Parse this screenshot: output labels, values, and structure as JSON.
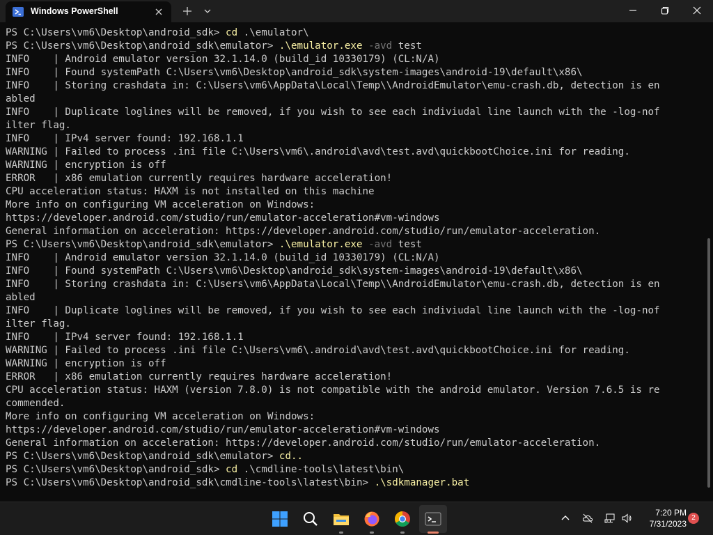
{
  "window": {
    "tab_title": "Windows PowerShell"
  },
  "terminal": {
    "lines": [
      [
        {
          "t": "PS C:\\Users\\vm6\\Desktop\\android_sdk> ",
          "c": ""
        },
        {
          "t": "cd",
          "c": "cmd"
        },
        {
          "t": " .\\emulator\\",
          "c": ""
        }
      ],
      [
        {
          "t": "PS C:\\Users\\vm6\\Desktop\\android_sdk\\emulator> ",
          "c": ""
        },
        {
          "t": ".\\emulator.exe",
          "c": "cmd"
        },
        {
          "t": " ",
          "c": ""
        },
        {
          "t": "-avd",
          "c": "param"
        },
        {
          "t": " test",
          "c": ""
        }
      ],
      [
        {
          "t": "INFO    | Android emulator version 32.1.14.0 (build_id 10330179) (CL:N/A)",
          "c": ""
        }
      ],
      [
        {
          "t": "INFO    | Found systemPath C:\\Users\\vm6\\Desktop\\android_sdk\\system-images\\android-19\\default\\x86\\",
          "c": ""
        }
      ],
      [
        {
          "t": "INFO    | Storing crashdata in: C:\\Users\\vm6\\AppData\\Local\\Temp\\\\AndroidEmulator\\emu-crash.db, detection is en",
          "c": ""
        }
      ],
      [
        {
          "t": "abled",
          "c": ""
        }
      ],
      [
        {
          "t": "INFO    | Duplicate loglines will be removed, if you wish to see each indiviudal line launch with the -log-nof",
          "c": ""
        }
      ],
      [
        {
          "t": "ilter flag.",
          "c": ""
        }
      ],
      [
        {
          "t": "INFO    | IPv4 server found: 192.168.1.1",
          "c": ""
        }
      ],
      [
        {
          "t": "WARNING | Failed to process .ini file C:\\Users\\vm6\\.android\\avd\\test.avd\\quickbootChoice.ini for reading.",
          "c": ""
        }
      ],
      [
        {
          "t": "WARNING | encryption is off",
          "c": ""
        }
      ],
      [
        {
          "t": "ERROR   | x86 emulation currently requires hardware acceleration!",
          "c": ""
        }
      ],
      [
        {
          "t": "CPU acceleration status: HAXM is not installed on this machine",
          "c": ""
        }
      ],
      [
        {
          "t": "More info on configuring VM acceleration on Windows:",
          "c": ""
        }
      ],
      [
        {
          "t": "https://developer.android.com/studio/run/emulator-acceleration#vm-windows",
          "c": ""
        }
      ],
      [
        {
          "t": "General information on acceleration: https://developer.android.com/studio/run/emulator-acceleration.",
          "c": ""
        }
      ],
      [
        {
          "t": "PS C:\\Users\\vm6\\Desktop\\android_sdk\\emulator> ",
          "c": ""
        },
        {
          "t": ".\\emulator.exe",
          "c": "cmd"
        },
        {
          "t": " ",
          "c": ""
        },
        {
          "t": "-avd",
          "c": "param"
        },
        {
          "t": " test",
          "c": ""
        }
      ],
      [
        {
          "t": "INFO    | Android emulator version 32.1.14.0 (build_id 10330179) (CL:N/A)",
          "c": ""
        }
      ],
      [
        {
          "t": "INFO    | Found systemPath C:\\Users\\vm6\\Desktop\\android_sdk\\system-images\\android-19\\default\\x86\\",
          "c": ""
        }
      ],
      [
        {
          "t": "INFO    | Storing crashdata in: C:\\Users\\vm6\\AppData\\Local\\Temp\\\\AndroidEmulator\\emu-crash.db, detection is en",
          "c": ""
        }
      ],
      [
        {
          "t": "abled",
          "c": ""
        }
      ],
      [
        {
          "t": "INFO    | Duplicate loglines will be removed, if you wish to see each indiviudal line launch with the -log-nof",
          "c": ""
        }
      ],
      [
        {
          "t": "ilter flag.",
          "c": ""
        }
      ],
      [
        {
          "t": "INFO    | IPv4 server found: 192.168.1.1",
          "c": ""
        }
      ],
      [
        {
          "t": "WARNING | Failed to process .ini file C:\\Users\\vm6\\.android\\avd\\test.avd\\quickbootChoice.ini for reading.",
          "c": ""
        }
      ],
      [
        {
          "t": "WARNING | encryption is off",
          "c": ""
        }
      ],
      [
        {
          "t": "ERROR   | x86 emulation currently requires hardware acceleration!",
          "c": ""
        }
      ],
      [
        {
          "t": "CPU acceleration status: HAXM (version 7.8.0) is not compatible with the android emulator. Version 7.6.5 is re",
          "c": ""
        }
      ],
      [
        {
          "t": "commended.",
          "c": ""
        }
      ],
      [
        {
          "t": "More info on configuring VM acceleration on Windows:",
          "c": ""
        }
      ],
      [
        {
          "t": "https://developer.android.com/studio/run/emulator-acceleration#vm-windows",
          "c": ""
        }
      ],
      [
        {
          "t": "General information on acceleration: https://developer.android.com/studio/run/emulator-acceleration.",
          "c": ""
        }
      ],
      [
        {
          "t": "PS C:\\Users\\vm6\\Desktop\\android_sdk\\emulator> ",
          "c": ""
        },
        {
          "t": "cd..",
          "c": "cmd"
        }
      ],
      [
        {
          "t": "PS C:\\Users\\vm6\\Desktop\\android_sdk> ",
          "c": ""
        },
        {
          "t": "cd",
          "c": "cmd"
        },
        {
          "t": " .\\cmdline-tools\\latest\\bin\\",
          "c": ""
        }
      ],
      [
        {
          "t": "PS C:\\Users\\vm6\\Desktop\\android_sdk\\cmdline-tools\\latest\\bin> ",
          "c": ""
        },
        {
          "t": ".\\sdkmanager.bat",
          "c": "cmd"
        }
      ]
    ]
  },
  "taskbar": {
    "apps": [
      {
        "name": "start-button",
        "icon": "windows-logo-icon"
      },
      {
        "name": "search-button",
        "icon": "search-icon"
      },
      {
        "name": "file-explorer",
        "icon": "folder-icon"
      },
      {
        "name": "firefox",
        "icon": "firefox-icon"
      },
      {
        "name": "chrome",
        "icon": "chrome-icon"
      },
      {
        "name": "terminal",
        "icon": "terminal-icon"
      }
    ],
    "tray": {
      "time": "7:20 PM",
      "date": "7/31/2023",
      "notification_count": "2"
    }
  },
  "colors": {
    "background": "#0c0c0c",
    "foreground": "#cccccc",
    "command": "#f9f1a5",
    "parameter": "#767676",
    "accent": "#e8836a"
  }
}
